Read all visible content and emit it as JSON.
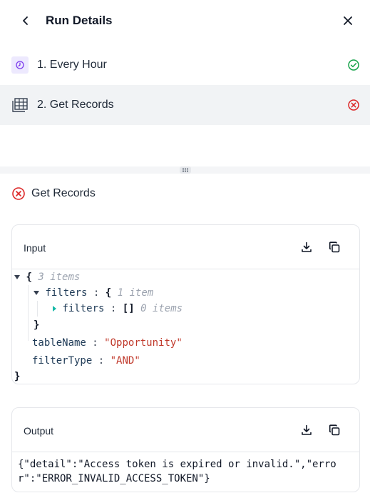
{
  "header": {
    "title": "Run Details"
  },
  "steps": [
    {
      "label": "1. Every Hour",
      "icon": "clock-icon",
      "status": "success"
    },
    {
      "label": "2. Get Records",
      "icon": "table-icon",
      "status": "error"
    }
  ],
  "detail": {
    "title": "Get Records",
    "status": "error"
  },
  "input_panel": {
    "title": "Input",
    "root_meta": "3 items",
    "filters_key": "filters",
    "filters_meta": "1 item",
    "nested_filters_key": "filters",
    "nested_filters_value": "[]",
    "nested_filters_meta": "0 items",
    "tableName_key": "tableName",
    "tableName_value": "\"Opportunity\"",
    "filterType_key": "filterType",
    "filterType_value": "\"AND\""
  },
  "output_panel": {
    "title": "Output",
    "text": "{\"detail\":\"Access token is expired or invalid.\",\"error\":\"ERROR_INVALID_ACCESS_TOKEN\"}"
  },
  "colors": {
    "success": "#16a34a",
    "error": "#dc2626",
    "selected_row": "#f1f3f5",
    "accent_purple": "#7c3aed"
  }
}
